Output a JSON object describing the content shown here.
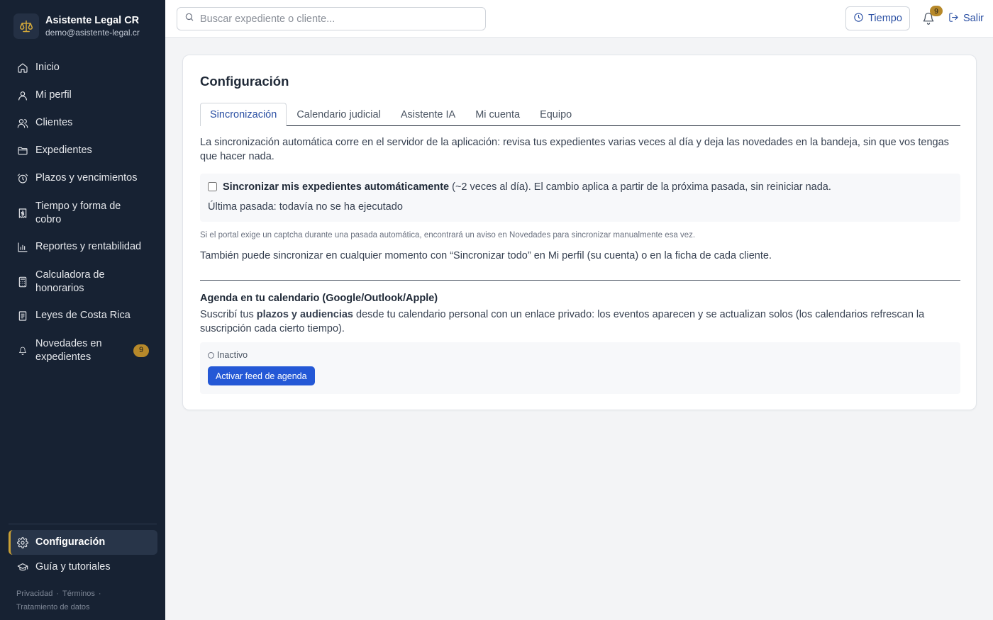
{
  "app": {
    "name": "Asistente Legal CR",
    "email": "demo@asistente-legal.cr"
  },
  "sidebar": {
    "items": [
      {
        "label": "Inicio",
        "icon": "home-icon"
      },
      {
        "label": "Mi perfil",
        "icon": "user-icon"
      },
      {
        "label": "Clientes",
        "icon": "users-icon"
      },
      {
        "label": "Expedientes",
        "icon": "folder-icon"
      },
      {
        "label": "Plazos y vencimientos",
        "icon": "alarm-clock-icon"
      },
      {
        "label": "Tiempo y forma de cobro",
        "icon": "receipt-icon"
      },
      {
        "label": "Reportes y rentabilidad",
        "icon": "bar-chart-icon"
      },
      {
        "label": "Calculadora de honorarios",
        "icon": "calculator-icon"
      },
      {
        "label": "Leyes de Costa Rica",
        "icon": "document-icon"
      },
      {
        "label": "Novedades en expedientes",
        "icon": "bell-icon",
        "badge": "9"
      }
    ],
    "bottom": [
      {
        "label": "Configuración",
        "icon": "gear-icon",
        "active": true
      },
      {
        "label": "Guía y tutoriales",
        "icon": "graduation-cap-icon"
      }
    ],
    "footer": {
      "privacy": "Privacidad",
      "terms": "Términos",
      "data": "Tratamiento de datos"
    }
  },
  "topbar": {
    "search_placeholder": "Buscar expediente o cliente...",
    "time_button": "Tiempo",
    "notification_count": "9",
    "logout": "Salir"
  },
  "main": {
    "title": "Configuración",
    "tabs": [
      {
        "label": "Sincronización",
        "active": true
      },
      {
        "label": "Calendario judicial"
      },
      {
        "label": "Asistente IA"
      },
      {
        "label": "Mi cuenta"
      },
      {
        "label": "Equipo"
      }
    ],
    "sync": {
      "intro": "La sincronización automática corre en el servidor de la aplicación: revisa tus expedientes varias veces al día y deja las novedades en la bandeja, sin que vos tengas que hacer nada.",
      "checkbox_label_bold": "Sincronizar mis expedientes automáticamente",
      "checkbox_label_rest": " (~2 veces al día). El cambio aplica a partir de la próxima pasada, sin reiniciar nada.",
      "checked": false,
      "last_run": "Última pasada: todavía no se ha ejecutado",
      "captcha_note": "Si el portal exige un captcha durante una pasada automática, encontrará un aviso en Novedades para sincronizar manualmente esa vez.",
      "manual_note": "También puede sincronizar en cualquier momento con “Sincronizar todo” en Mi perfil (su cuenta) o en la ficha de cada cliente."
    },
    "agenda": {
      "title": "Agenda en tu calendario (Google/Outlook/Apple)",
      "desc_pre": "Suscribí tus ",
      "desc_bold": "plazos y audiencias",
      "desc_post": " desde tu calendario personal con un enlace privado: los eventos aparecen y se actualizan solos (los calendarios refrescan la suscripción cada cierto tiempo).",
      "status": "Inactivo",
      "activate_button": "Activar feed de agenda"
    }
  },
  "colors": {
    "sidebar_bg": "#172233",
    "accent_gold": "#b7892a",
    "primary_blue": "#2458d6",
    "link_blue": "#2a4fa3"
  }
}
